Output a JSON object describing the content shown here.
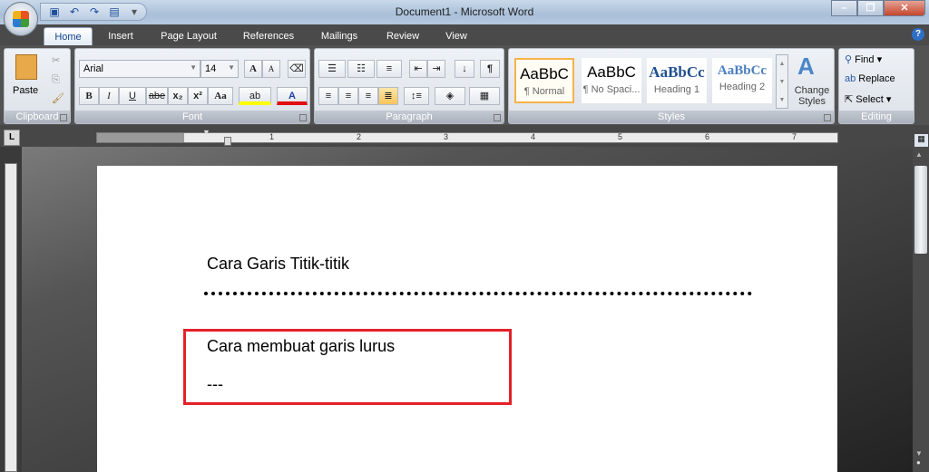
{
  "window": {
    "title": "Document1 - Microsoft Word",
    "controls": [
      "minimize",
      "restore",
      "close"
    ]
  },
  "tabs": [
    {
      "label": "Home",
      "active": true
    },
    {
      "label": "Insert"
    },
    {
      "label": "Page Layout"
    },
    {
      "label": "References"
    },
    {
      "label": "Mailings"
    },
    {
      "label": "Review"
    },
    {
      "label": "View"
    }
  ],
  "ribbon": {
    "clipboard": {
      "label": "Clipboard",
      "paste": "Paste"
    },
    "font": {
      "label": "Font",
      "font_name": "Arial",
      "font_size": "14",
      "bold": "B",
      "italic": "I",
      "underline": "U",
      "strike": "abe",
      "subscript": "x₂",
      "superscript": "x²",
      "change_case": "Aa",
      "grow": "A",
      "shrink": "A",
      "highlight_color": "#ffff00",
      "font_color": "#e01010"
    },
    "paragraph": {
      "label": "Paragraph",
      "pilcrow": "¶"
    },
    "styles": {
      "label": "Styles",
      "items": [
        {
          "preview": "AaBbC",
          "name": "¶ Normal",
          "active": true
        },
        {
          "preview": "AaBbC",
          "name": "¶ No Spaci..."
        },
        {
          "preview": "AaBbCc",
          "name": "Heading 1"
        },
        {
          "preview": "AaBbCc",
          "name": "Heading 2"
        }
      ],
      "change_styles": "Change Styles"
    },
    "editing": {
      "label": "Editing",
      "find": "Find",
      "replace": "Replace",
      "select": "Select"
    }
  },
  "ruler": {
    "numbers": [
      "1",
      "2",
      "3",
      "4",
      "5",
      "6",
      "7"
    ]
  },
  "document": {
    "line1": "Cara Garis Titik-titik",
    "line2": "Cara membuat garis lurus",
    "line3": "---",
    "highlight_box_color": "#e32028"
  }
}
